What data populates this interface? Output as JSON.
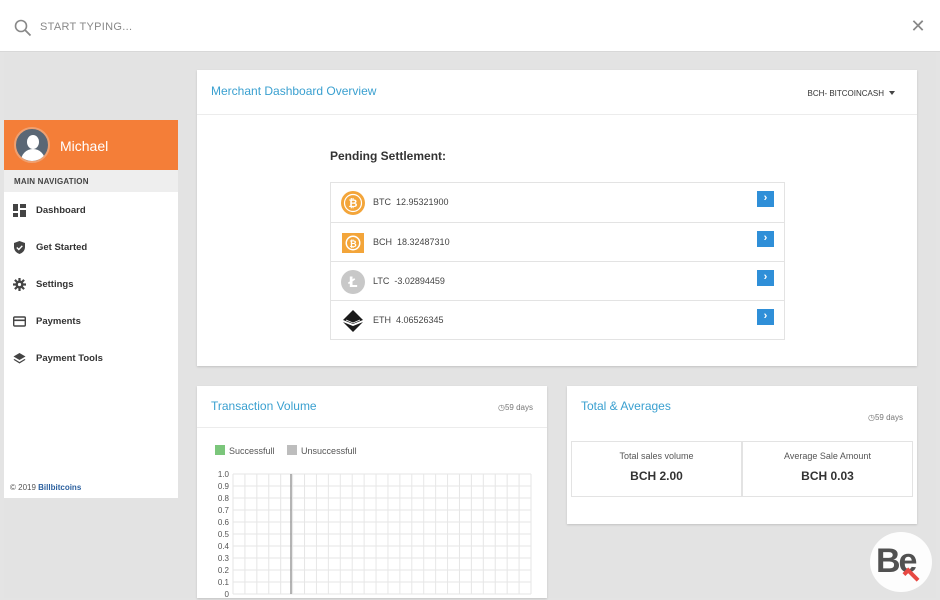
{
  "search": {
    "placeholder": "START TYPING..."
  },
  "sidebar": {
    "user_name": "Michael",
    "nav_header": "MAIN NAVIGATION",
    "items": [
      {
        "label": "Dashboard",
        "icon": "dashboard-icon"
      },
      {
        "label": "Get Started",
        "icon": "shield-check-icon"
      },
      {
        "label": "Settings",
        "icon": "gear-icon"
      },
      {
        "label": "Payments",
        "icon": "credit-card-icon"
      },
      {
        "label": "Payment Tools",
        "icon": "layers-icon"
      }
    ],
    "copyright_prefix": "© 2019",
    "copyright_brand": "Billbitcoins"
  },
  "overview": {
    "title": "Merchant Dashboard Overview",
    "currency_selected": "BCH- BITCOINCASH",
    "pending_title": "Pending Settlement:",
    "coins": [
      {
        "symbol": "BTC",
        "amount": "12.95321900",
        "icon": "bitcoin-icon"
      },
      {
        "symbol": "BCH",
        "amount": "18.32487310",
        "icon": "bitcoin-cash-icon"
      },
      {
        "symbol": "LTC",
        "amount": "-3.02894459",
        "icon": "litecoin-icon"
      },
      {
        "symbol": "ETH",
        "amount": "4.06526345",
        "icon": "ethereum-icon"
      }
    ]
  },
  "volume": {
    "title": "Transaction Volume",
    "time": "59 days",
    "legend": [
      {
        "label": "Successfull",
        "color": "#7bc67b"
      },
      {
        "label": "Unsuccessfull",
        "color": "#bdbdbd"
      }
    ]
  },
  "chart_data": {
    "type": "bar",
    "title": "",
    "xlabel": "",
    "ylabel": "",
    "ylim": [
      0,
      1.0
    ],
    "yticks": [
      "0",
      "0.1",
      "0.2",
      "0.3",
      "0.4",
      "0.5",
      "0.6",
      "0.7",
      "0.8",
      "0.9",
      "1.0"
    ],
    "grid": true,
    "legend_placement": "top-left",
    "series": [
      {
        "name": "Successfull",
        "values": []
      },
      {
        "name": "Unsuccessfull",
        "values": []
      }
    ]
  },
  "totals": {
    "title": "Total & Averages",
    "time": "59 days",
    "stats": [
      {
        "label": "Total sales volume",
        "value": "BCH 2.00"
      },
      {
        "label": "Average Sale Amount",
        "value": "BCH 0.03"
      }
    ]
  },
  "watermark": {
    "text": "Be"
  }
}
